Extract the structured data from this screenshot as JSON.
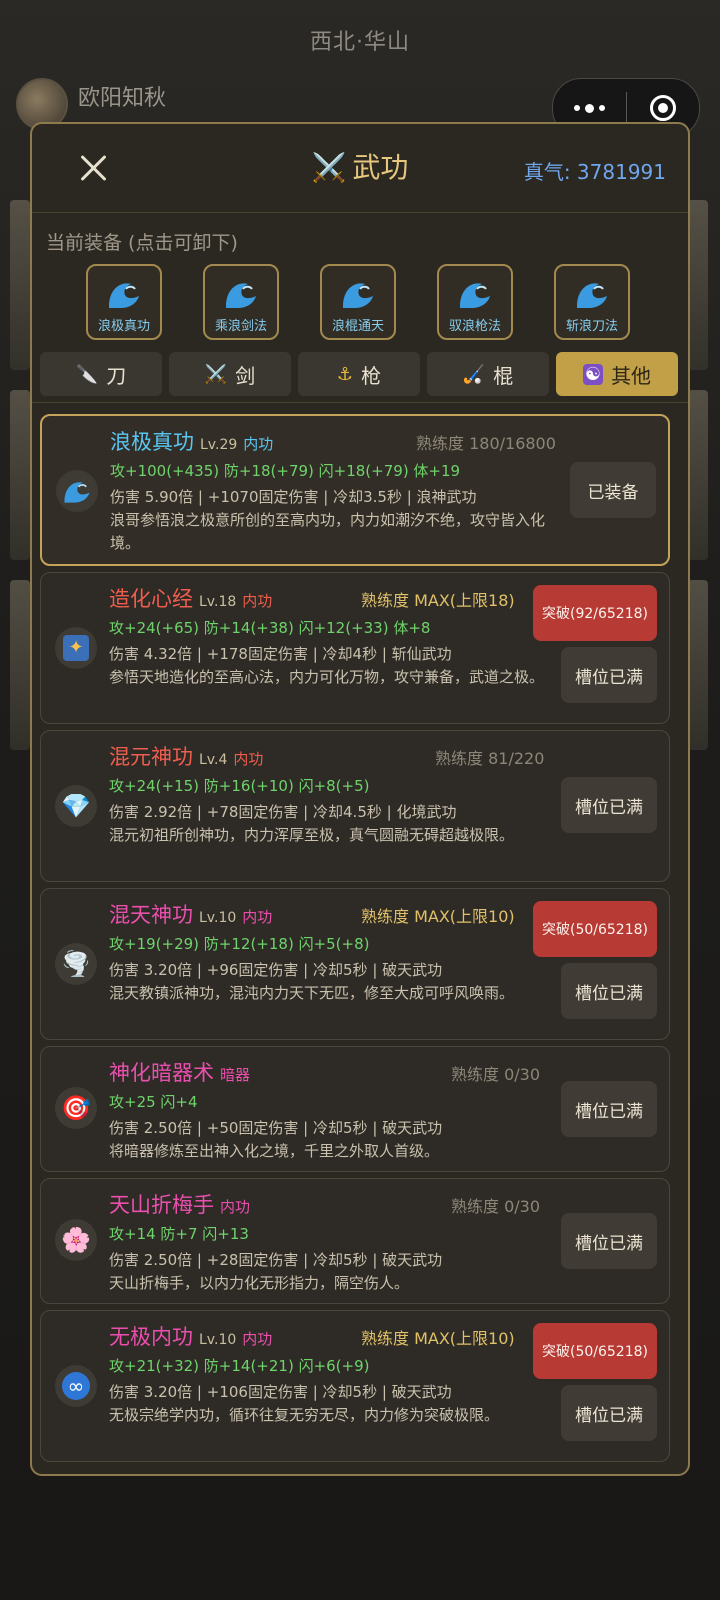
{
  "background": {
    "location": "西北·华山",
    "player_name": "欧阳知秋"
  },
  "panel": {
    "title": "武功",
    "title_icon": "crossed-swords-icon",
    "qi_label": "真气: 3781991"
  },
  "equipped": {
    "label": "当前装备 (点击可卸下)",
    "items": [
      {
        "name": "浪极真功"
      },
      {
        "name": "乘浪剑法"
      },
      {
        "name": "浪棍通天"
      },
      {
        "name": "驭浪枪法"
      },
      {
        "name": "斩浪刀法"
      }
    ]
  },
  "tabs": [
    {
      "label": "刀",
      "icon": "dagger-icon"
    },
    {
      "label": "剑",
      "icon": "crossed-swords-icon"
    },
    {
      "label": "枪",
      "icon": "spear-icon"
    },
    {
      "label": "棍",
      "icon": "staff-icon"
    },
    {
      "label": "其他",
      "icon": "yin-yang-icon",
      "active": true
    }
  ],
  "skills": [
    {
      "name": "浪极真功",
      "level": "Lv.29",
      "kind": "内功",
      "proficiency": "熟练度 180/16800",
      "stats": "攻+100(+435) 防+18(+79) 闪+18(+79) 体+19",
      "desc": "伤害 5.90倍 | +1070固定伤害 | 冷却3.5秒 | 浪神武功",
      "desc2": "浪哥参悟浪之极意所创的至高内功，内力如潮汐不绝，攻守皆入化境。",
      "button": "已装备",
      "icon": "wave-icon",
      "name_color": "#59c6f2",
      "kind_color": "#59c6f2"
    },
    {
      "name": "造化心经",
      "level": "Lv.18",
      "kind": "内功",
      "proficiency": "熟练度 MAX(上限18)",
      "stats": "攻+24(+65) 防+14(+38) 闪+12(+33) 体+8",
      "desc": "伤害 4.32倍 | +178固定伤害 | 冷却4秒 | 斩仙武功",
      "desc2": "参悟天地造化的至高心法，内力可化万物，攻守兼备，武道之极。",
      "break_button": "突破(92/65218)",
      "button": "槽位已满",
      "icon": "scroll-icon",
      "name_color": "#ee5d4e",
      "kind_color": "#ee5d4e"
    },
    {
      "name": "混元神功",
      "level": "Lv.4",
      "kind": "内功",
      "proficiency": "熟练度 81/220",
      "stats": "攻+24(+15) 防+16(+10) 闪+8(+5)",
      "desc": "伤害 2.92倍 | +78固定伤害 | 冷却4.5秒 | 化境武功",
      "desc2": "混元初祖所创神功，内力浑厚至极，真气圆融无碍超越极限。",
      "button": "槽位已满",
      "icon": "diamond-icon",
      "name_color": "#ee5d4e",
      "kind_color": "#ee5d4e"
    },
    {
      "name": "混天神功",
      "level": "Lv.10",
      "kind": "内功",
      "proficiency": "熟练度 MAX(上限10)",
      "stats": "攻+19(+29) 防+12(+18) 闪+5(+8)",
      "desc": "伤害 3.20倍 | +96固定伤害 | 冷却5秒 | 破天武功",
      "desc2": "混天教镇派神功，混沌内力天下无匹，修至大成可呼风唤雨。",
      "break_button": "突破(50/65218)",
      "button": "槽位已满",
      "icon": "tornado-icon",
      "name_color": "#ea4fae",
      "kind_color": "#ea4fae"
    },
    {
      "name": "神化暗器术",
      "level": "",
      "kind": "暗器",
      "proficiency": "熟练度 0/30",
      "stats": "攻+25 闪+4",
      "desc": "伤害 2.50倍 | +50固定伤害 | 冷却5秒 | 破天武功",
      "desc2": "将暗器修炼至出神入化之境，千里之外取人首级。",
      "button": "槽位已满",
      "icon": "target-icon",
      "name_color": "#ea4fae",
      "kind_color": "#ea4fae"
    },
    {
      "name": "天山折梅手",
      "level": "",
      "kind": "内功",
      "proficiency": "熟练度 0/30",
      "stats": "攻+14 防+7 闪+13",
      "desc": "伤害 2.50倍 | +28固定伤害 | 冷却5秒 | 破天武功",
      "desc2": "天山折梅手，以内力化无形指力，隔空伤人。",
      "button": "槽位已满",
      "icon": "blossom-icon",
      "name_color": "#ea4fae",
      "kind_color": "#ea4fae"
    },
    {
      "name": "无极内功",
      "level": "Lv.10",
      "kind": "内功",
      "proficiency": "熟练度 MAX(上限10)",
      "stats": "攻+21(+32) 防+14(+21) 闪+6(+9)",
      "desc": "伤害 3.20倍 | +106固定伤害 | 冷却5秒 | 破天武功",
      "desc2": "无极宗绝学内功，循环往复无穷无尽，内力修为突破极限。",
      "break_button": "突破(50/65218)",
      "button": "槽位已满",
      "icon": "infinity-icon",
      "name_color": "#ea4fae",
      "kind_color": "#ea4fae"
    }
  ]
}
